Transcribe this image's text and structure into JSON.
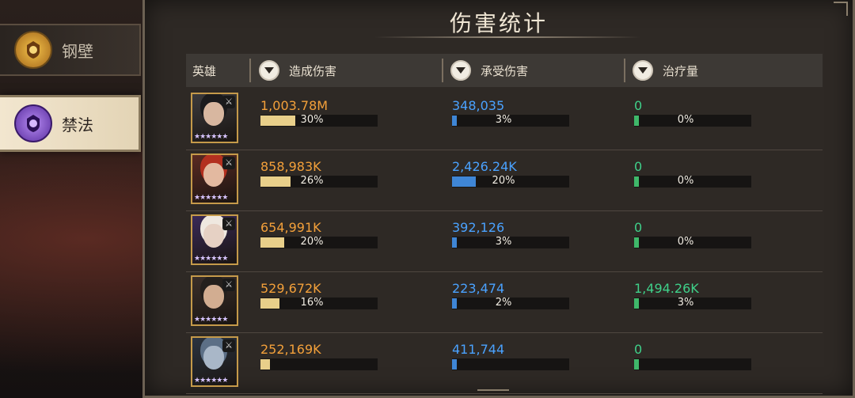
{
  "sidebar": {
    "tabs": [
      {
        "label": "钢壁",
        "icon": "gold-crest-icon",
        "active": false
      },
      {
        "label": "禁法",
        "icon": "purple-crest-icon",
        "active": true
      }
    ]
  },
  "panel": {
    "title": "伤害统计",
    "columns": {
      "hero": "英雄",
      "damage_dealt": "造成伤害",
      "damage_taken": "承受伤害",
      "healing": "治疗量"
    }
  },
  "rows": [
    {
      "dealt": "1,003.78M",
      "dealt_pct": "30%",
      "dealt_frac": 0.3,
      "taken": "348,035",
      "taken_pct": "3%",
      "taken_frac": 0.03,
      "heal": "0",
      "heal_pct": "0%",
      "heal_frac": 0.0,
      "avatar_bg": "#3b3a3d",
      "face": "#d8b7a0",
      "hair": "#1b1b1d"
    },
    {
      "dealt": "858,983K",
      "dealt_pct": "26%",
      "dealt_frac": 0.26,
      "taken": "2,426.24K",
      "taken_pct": "20%",
      "taken_frac": 0.2,
      "heal": "0",
      "heal_pct": "0%",
      "heal_frac": 0.0,
      "avatar_bg": "#5a2a22",
      "face": "#e3b9a0",
      "hair": "#b3301f"
    },
    {
      "dealt": "654,991K",
      "dealt_pct": "20%",
      "dealt_frac": 0.2,
      "taken": "392,126",
      "taken_pct": "3%",
      "taken_frac": 0.03,
      "heal": "0",
      "heal_pct": "0%",
      "heal_frac": 0.0,
      "avatar_bg": "#3a2a58",
      "face": "#e6d1c4",
      "hair": "#efe8e0"
    },
    {
      "dealt": "529,672K",
      "dealt_pct": "16%",
      "dealt_frac": 0.16,
      "taken": "223,474",
      "taken_pct": "2%",
      "taken_frac": 0.02,
      "heal": "1,494.26K",
      "heal_pct": "3%",
      "heal_frac": 0.03,
      "avatar_bg": "#3a2f2a",
      "face": "#d2ad91",
      "hair": "#24201d"
    },
    {
      "dealt": "252,169K",
      "dealt_pct": "",
      "dealt_frac": 0.08,
      "taken": "411,744",
      "taken_pct": "",
      "taken_frac": 0.03,
      "heal": "0",
      "heal_pct": "",
      "heal_frac": 0.0,
      "avatar_bg": "#2a3340",
      "face": "#a9b7c8",
      "hair": "#5c6f86"
    }
  ],
  "colors": {
    "dealt_bar": "#e8cf8a",
    "taken_bar": "#3f86d6",
    "heal_bar": "#3fb86a"
  }
}
